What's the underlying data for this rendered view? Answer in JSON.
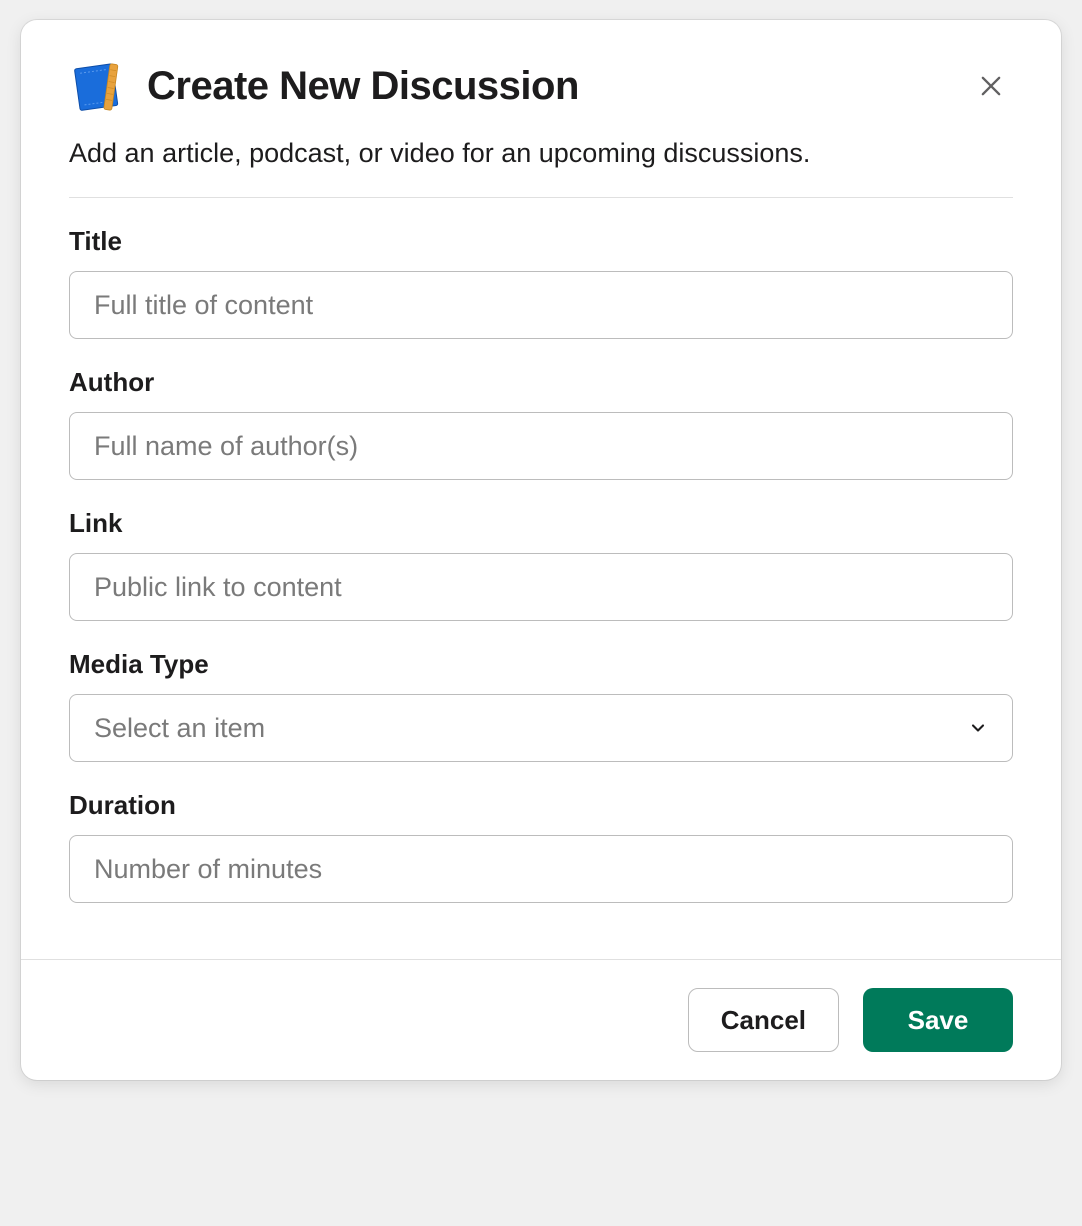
{
  "modal": {
    "title": "Create New Discussion",
    "description": "Add an article, podcast, or video for an upcoming discussions."
  },
  "form": {
    "title": {
      "label": "Title",
      "placeholder": "Full title of content",
      "value": ""
    },
    "author": {
      "label": "Author",
      "placeholder": "Full name of author(s)",
      "value": ""
    },
    "link": {
      "label": "Link",
      "placeholder": "Public link to content",
      "value": ""
    },
    "mediaType": {
      "label": "Media Type",
      "placeholder": "Select an item",
      "value": ""
    },
    "duration": {
      "label": "Duration",
      "placeholder": "Number of minutes",
      "value": ""
    }
  },
  "footer": {
    "cancel": "Cancel",
    "save": "Save"
  }
}
